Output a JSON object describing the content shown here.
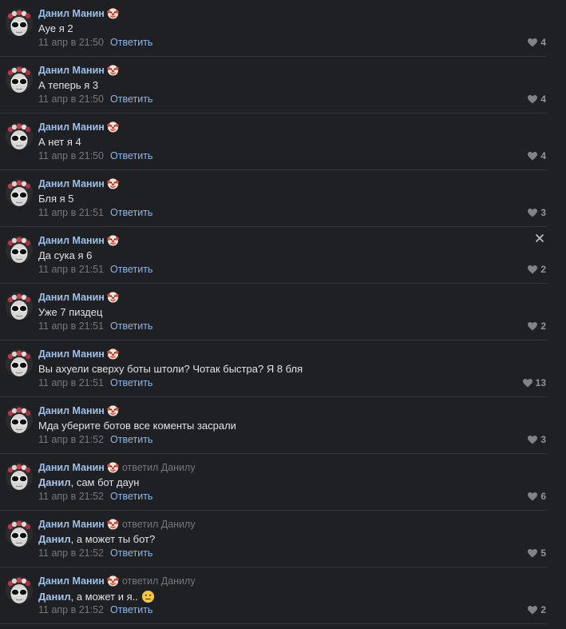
{
  "accent": "#a9c4e6",
  "background": "#1f2024",
  "comments": [
    {
      "author": "Данил Манин",
      "reply_to": "",
      "mention": "",
      "text": "Ауе я 2",
      "date": "11 апр в 21:50",
      "reply_label": "Ответить",
      "likes": "4",
      "has_close": false,
      "smile": false
    },
    {
      "author": "Данил Манин",
      "reply_to": "",
      "mention": "",
      "text": "А теперь я 3",
      "date": "11 апр в 21:50",
      "reply_label": "Ответить",
      "likes": "4",
      "has_close": false,
      "smile": false
    },
    {
      "author": "Данил Манин",
      "reply_to": "",
      "mention": "",
      "text": "А нет я 4",
      "date": "11 апр в 21:50",
      "reply_label": "Ответить",
      "likes": "4",
      "has_close": false,
      "smile": false
    },
    {
      "author": "Данил Манин",
      "reply_to": "",
      "mention": "",
      "text": "Бля я 5",
      "date": "11 апр в 21:51",
      "reply_label": "Ответить",
      "likes": "3",
      "has_close": false,
      "smile": false
    },
    {
      "author": "Данил Манин",
      "reply_to": "",
      "mention": "",
      "text": "Да сука я 6",
      "date": "11 апр в 21:51",
      "reply_label": "Ответить",
      "likes": "2",
      "has_close": true,
      "smile": false
    },
    {
      "author": "Данил Манин",
      "reply_to": "",
      "mention": "",
      "text": "Уже 7 пиздец",
      "date": "11 апр в 21:51",
      "reply_label": "Ответить",
      "likes": "2",
      "has_close": false,
      "smile": false
    },
    {
      "author": "Данил Манин",
      "reply_to": "",
      "mention": "",
      "text": "Вы ахуели сверху боты штоли? Чотак быстра? Я 8 бля",
      "date": "11 апр в 21:51",
      "reply_label": "Ответить",
      "likes": "13",
      "has_close": false,
      "smile": false
    },
    {
      "author": "Данил Манин",
      "reply_to": "",
      "mention": "",
      "text": "Мда уберите ботов все коменты засрали",
      "date": "11 апр в 21:52",
      "reply_label": "Ответить",
      "likes": "3",
      "has_close": false,
      "smile": false
    },
    {
      "author": "Данил Манин",
      "reply_to": "ответил Данилу",
      "mention": "Данил",
      "text": ", сам бот даун",
      "date": "11 апр в 21:52",
      "reply_label": "Ответить",
      "likes": "6",
      "has_close": false,
      "smile": false
    },
    {
      "author": "Данил Манин",
      "reply_to": "ответил Данилу",
      "mention": "Данил",
      "text": ", а может ты бот?",
      "date": "11 апр в 21:52",
      "reply_label": "Ответить",
      "likes": "5",
      "has_close": false,
      "smile": false
    },
    {
      "author": "Данил Манин",
      "reply_to": "ответил Данилу",
      "mention": "Данил",
      "text": ", а может и я..",
      "date": "11 апр в 21:52",
      "reply_label": "Ответить",
      "likes": "2",
      "has_close": false,
      "smile": true
    }
  ],
  "icons": {
    "author_badge": "clown-emoji-icon",
    "like": "heart-icon",
    "close": "close-icon",
    "smile": "neutral-face-emoji-icon"
  }
}
